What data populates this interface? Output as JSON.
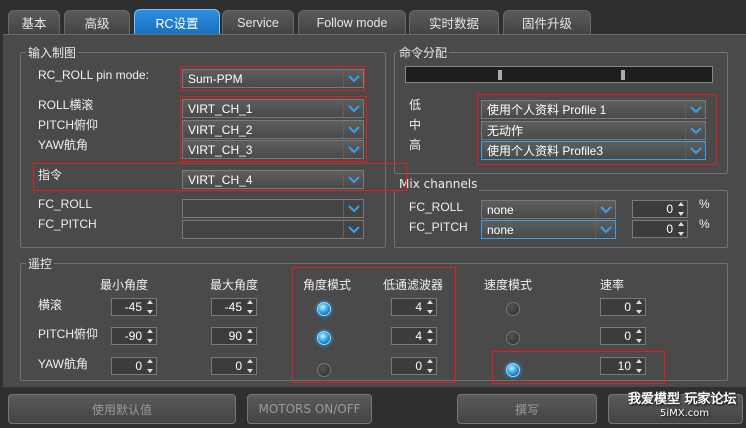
{
  "tabs": [
    {
      "label": "基本"
    },
    {
      "label": "高级"
    },
    {
      "label": "RC设置",
      "active": true
    },
    {
      "label": "Service"
    },
    {
      "label": "Follow mode"
    },
    {
      "label": "实时数据"
    },
    {
      "label": "固件升级"
    }
  ],
  "input_mapping": {
    "title": "输入制图",
    "roll_pin_mode_label": "RC_ROLL pin mode:",
    "roll_pin_mode_value": "Sum-PPM",
    "roll_label": "ROLL横滚",
    "roll_value": "VIRT_CH_1",
    "pitch_label": "PITCH俯仰",
    "pitch_value": "VIRT_CH_2",
    "yaw_label": "YAW航角",
    "yaw_value": "VIRT_CH_3",
    "cmd_label": "指令",
    "cmd_value": "VIRT_CH_4",
    "fc_roll_label": "FC_ROLL",
    "fc_roll_value": "",
    "fc_pitch_label": "FC_PITCH",
    "fc_pitch_value": ""
  },
  "command_assign": {
    "title": "命令分配",
    "low_label": "低",
    "low_value": "使用个人资料 Profile 1",
    "mid_label": "中",
    "mid_value": "无动作",
    "high_label": "高",
    "high_value": "使用个人资料 Profile3"
  },
  "mix": {
    "title": "Mix channels",
    "fc_roll_label": "FC_ROLL",
    "fc_roll_value": "none",
    "fc_roll_pct": "0",
    "fc_pitch_label": "FC_PITCH",
    "fc_pitch_value": "none",
    "fc_pitch_pct": "0",
    "pct_unit": "%"
  },
  "rc": {
    "title": "遥控",
    "headers": {
      "min": "最小角度",
      "max": "最大角度",
      "angle_mode": "角度模式",
      "lpf": "低通滤波器",
      "speed_mode": "速度模式",
      "rate": "速率"
    },
    "rows": [
      {
        "label": "横滚",
        "min": "-45",
        "max": "-45",
        "angle_mode": true,
        "lpf": "4",
        "speed_mode": false,
        "rate": "0"
      },
      {
        "label": "PITCH俯仰",
        "min": "-90",
        "max": "90",
        "angle_mode": true,
        "lpf": "4",
        "speed_mode": false,
        "rate": "0"
      },
      {
        "label": "YAW航角",
        "min": "0",
        "max": "0",
        "angle_mode": false,
        "lpf": "0",
        "speed_mode": true,
        "rate": "10"
      }
    ]
  },
  "buttons": {
    "defaults": "使用默认值",
    "motors": "MOTORS ON/OFF",
    "write": "撰写"
  },
  "watermark": {
    "line1": "我爱模型 玩家论坛",
    "line2": "5iMX.com"
  }
}
